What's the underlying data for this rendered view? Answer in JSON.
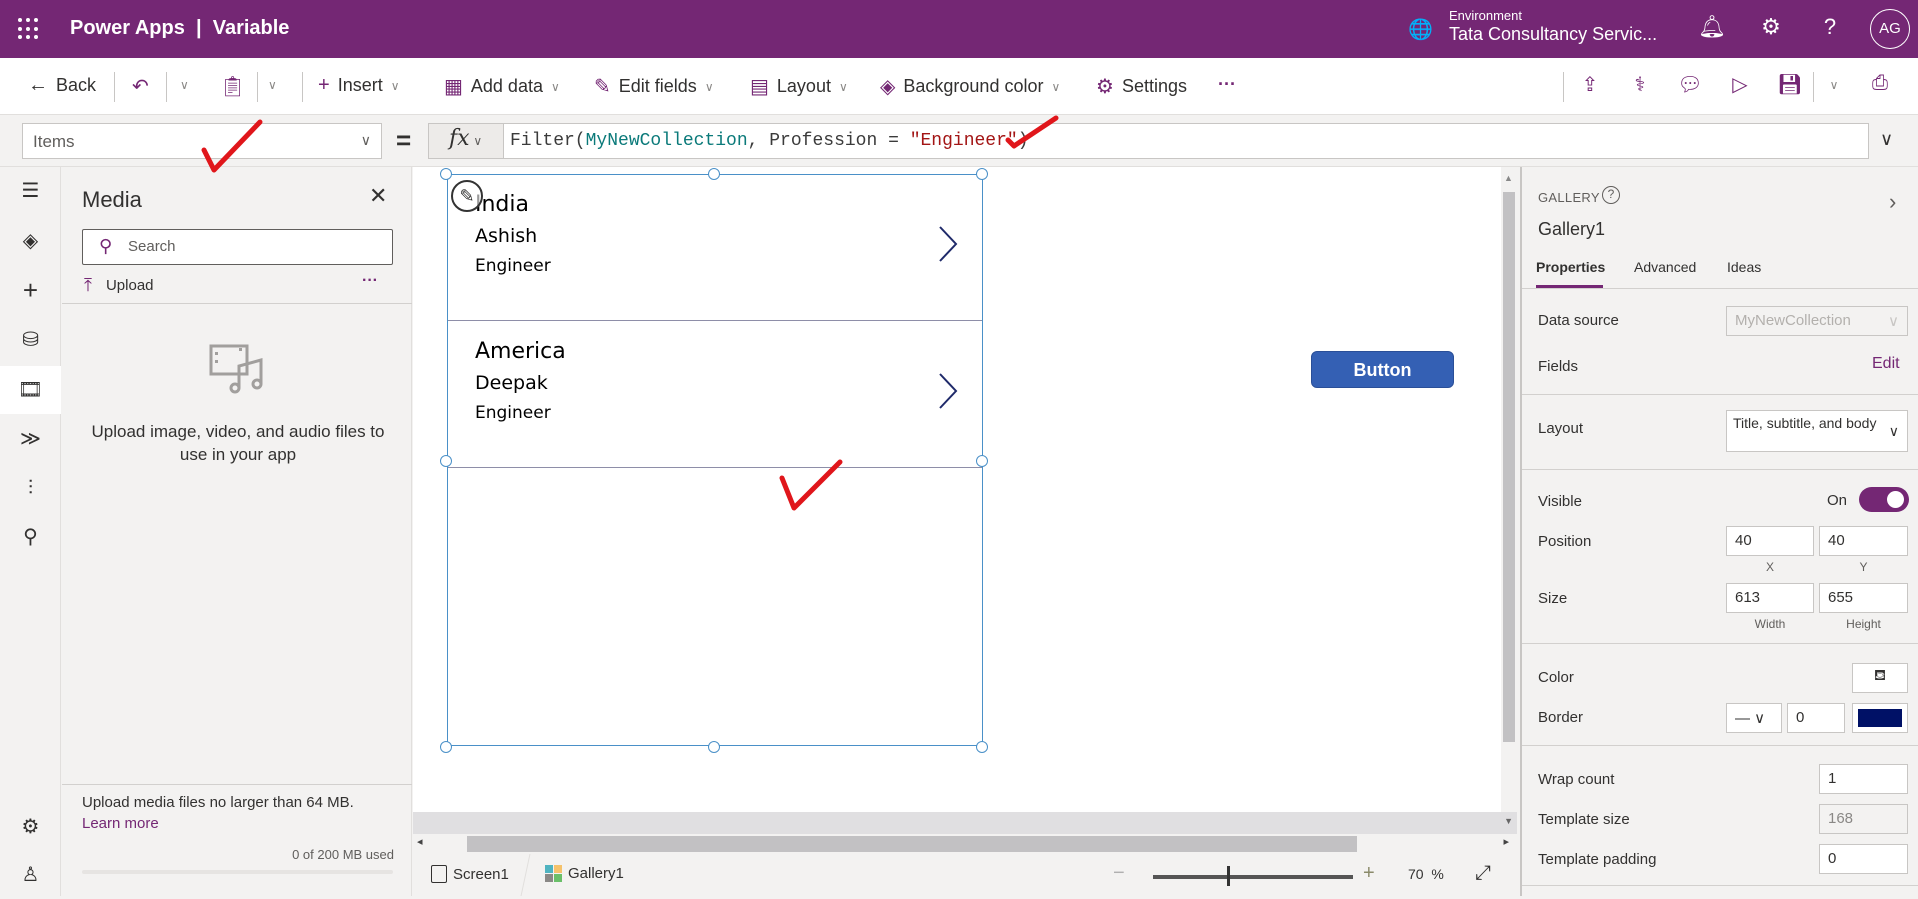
{
  "header": {
    "app_name": "Power Apps",
    "separator": "|",
    "app_title": "Variable",
    "environment_label": "Environment",
    "environment_value": "Tata Consultancy Servic...",
    "avatar_initials": "AG",
    "brand_color": "#742774"
  },
  "toolbar": {
    "back": "Back",
    "insert": "Insert",
    "add_data": "Add data",
    "edit_fields": "Edit fields",
    "layout": "Layout",
    "background_color": "Background color",
    "settings": "Settings",
    "more": "···"
  },
  "formula_bar": {
    "property": "Items",
    "equals": "=",
    "fx": "fx",
    "formula_parts": {
      "fn": "Filter(",
      "collection": "MyNewCollection",
      "mid": ", Profession = ",
      "str": "\"Engineer\"",
      "close": ")"
    }
  },
  "media_panel": {
    "title": "Media",
    "search_placeholder": "Search",
    "upload": "Upload",
    "more": "···",
    "empty_text": "Upload image, video, and audio files to use in your app",
    "limit_text": "Upload media files no larger than 64 MB.",
    "learn_more": "Learn more",
    "usage": "0 of 200 MB used",
    "usage_fraction": 0
  },
  "gallery": {
    "items": [
      {
        "title": "India",
        "subtitle": "Ashish",
        "body": "Engineer"
      },
      {
        "title": "America",
        "subtitle": "Deepak",
        "body": "Engineer"
      }
    ]
  },
  "canvas": {
    "button_label": "Button",
    "button_color": "#3460b4"
  },
  "status_bar": {
    "screen": "Screen1",
    "gallery": "Gallery1",
    "zoom": "70",
    "zoom_unit": "%"
  },
  "properties": {
    "control_type": "GALLERY",
    "control_name": "Gallery1",
    "tabs": [
      "Properties",
      "Advanced",
      "Ideas"
    ],
    "active_tab": "Properties",
    "data_source_label": "Data source",
    "data_source_value": "MyNewCollection",
    "fields_label": "Fields",
    "fields_action": "Edit",
    "layout_label": "Layout",
    "layout_value": "Title, subtitle, and body",
    "visible_label": "Visible",
    "visible_value": "On",
    "position_label": "Position",
    "position_x": "40",
    "position_y": "40",
    "x_label": "X",
    "y_label": "Y",
    "size_label": "Size",
    "width": "613",
    "height": "655",
    "width_label": "Width",
    "height_label": "Height",
    "color_label": "Color",
    "border_label": "Border",
    "border_width": "0",
    "border_color": "#001166",
    "wrap_count_label": "Wrap count",
    "wrap_count": "1",
    "template_size_label": "Template size",
    "template_size": "168",
    "template_padding_label": "Template padding",
    "template_padding": "0"
  }
}
